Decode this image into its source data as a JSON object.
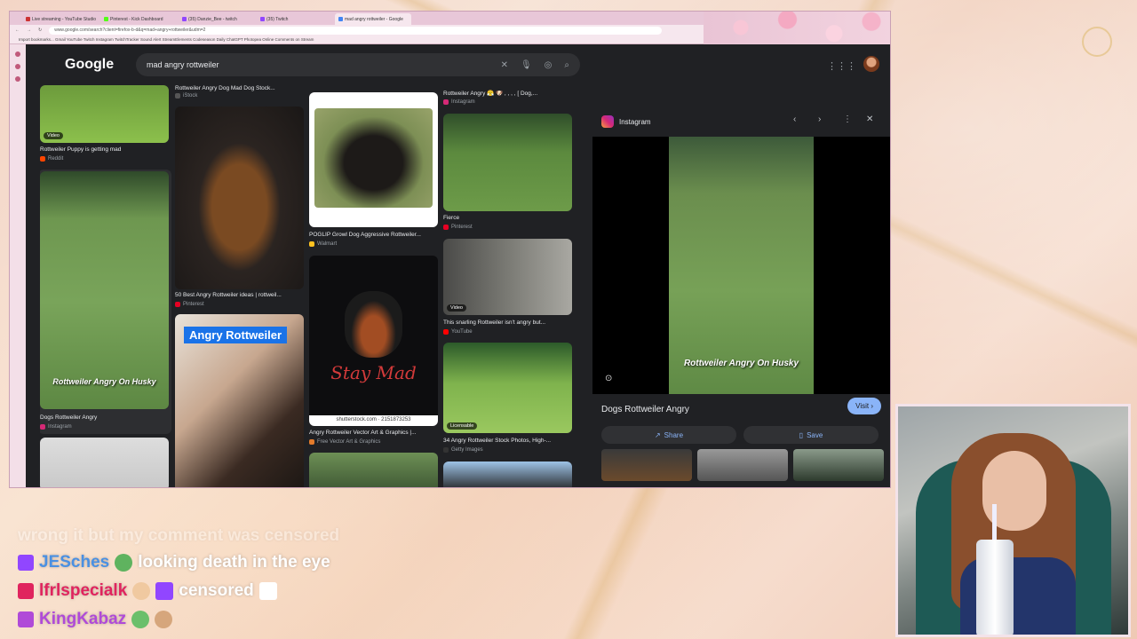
{
  "tabs": [
    "Live streaming - YouTube Studio",
    "Pinterest - Kick Dashboard",
    "(35) Danzie_Bee - twitch",
    "(35) Twitch",
    "mad angry rottweiler - Google"
  ],
  "url": "www.google.com/search?client=firefox-b-d&q=mad+angry+rottweiler&udm=2",
  "bookmarks": "Import bookmarks... Gmail YouTube Twitch Instagram TwitchTracker Sound Alert StreamElements Codeseason Daily ChatGPT Photopea Online Comments on Stream",
  "google": {
    "logo": "Google",
    "query": "mad angry rottweiler"
  },
  "results": [
    {
      "caption": "Rottweiler Puppy is getting mad",
      "source": "Reddit",
      "badge": "Video"
    },
    {
      "caption": "Dogs Rottweiler Angry",
      "source": "Instagram",
      "overlay": "Rottweiler Angry On Husky"
    },
    {
      "caption": "Rottweiler Angry Dog Mad Dog Stock...",
      "source": "iStock"
    },
    {
      "caption": "50 Best Angry Rottweiler ideas | rottweil...",
      "source": "Pinterest"
    },
    {
      "caption": "",
      "source": "",
      "label": "Angry Rottweiler"
    },
    {
      "caption": "POGLIP Growl Dog Aggressive Rottweiler...",
      "source": "Walmart"
    },
    {
      "caption": "Angry Rottweiler Vector Art & Graphics |...",
      "source": "Free Vector Art & Graphics",
      "art": "Stay Mad",
      "stock": "shutterstock.com · 2151873253"
    },
    {
      "caption": "Rottweiler Angry 😤 🐶 , , , , [ Dog,...",
      "source": "Instagram"
    },
    {
      "caption": "Fierce",
      "source": "Pinterest"
    },
    {
      "caption": "This snarling Rottweiler isn't angry but...",
      "source": "YouTube",
      "badge": "Video"
    },
    {
      "caption": "34 Angry Rottweiler Stock Photos, High-...",
      "source": "Getty Images",
      "badge": "Licensable"
    }
  ],
  "panel": {
    "source": "Instagram",
    "title": "Dogs Rottweiler Angry",
    "overlay": "Rottweiler Angry On Husky",
    "visit": "Visit ›",
    "share": "Share",
    "save": "Save"
  },
  "chat": [
    {
      "user": "",
      "msg": "wrong it but my comment was censored",
      "color": "#ffffff"
    },
    {
      "user": "JESches",
      "msg": "looking death in the eye",
      "color": "#4a90e2"
    },
    {
      "user": "lfrlspecialk",
      "msg": "censored",
      "color": "#e0245e"
    },
    {
      "user": "KingKabaz",
      "msg": "",
      "color": "#b04ad8"
    }
  ],
  "colors": {
    "accent": "#8ab4f8",
    "twitch": "#9146ff"
  }
}
